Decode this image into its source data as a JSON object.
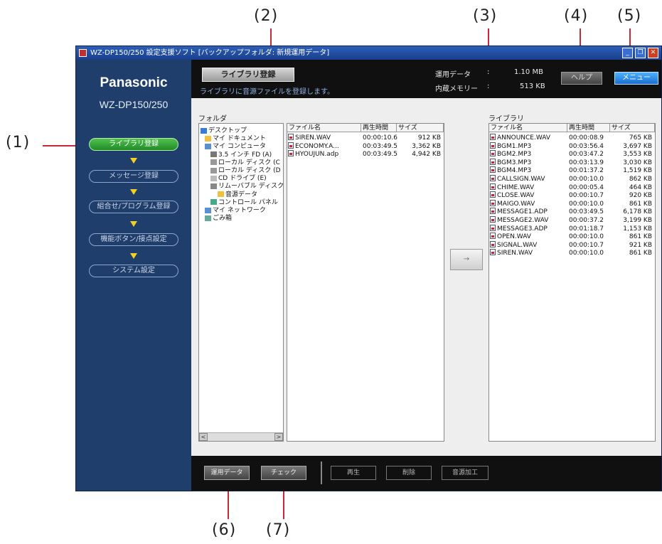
{
  "callouts": {
    "c1": "(1)",
    "c2": "(2)",
    "c3": "(3)",
    "c4": "(4)",
    "c5": "(5)",
    "c6": "(6)",
    "c7": "(7)"
  },
  "window": {
    "title": "WZ-DP150/250 設定支援ソフト [バックアップフォルダ: 新規運用データ]",
    "minimize": "_",
    "restore": "❐",
    "close": "✕"
  },
  "sidebar": {
    "brand": "Panasonic",
    "model": "WZ-DP150/250",
    "items": [
      {
        "label": "ライブラリ登録"
      },
      {
        "label": "メッセージ登録"
      },
      {
        "label": "組合せ/プログラム登録"
      },
      {
        "label": "機能ボタン/接点設定"
      },
      {
        "label": "システム設定"
      }
    ]
  },
  "header": {
    "library_button": "ライブラリ登録",
    "description": "ライブラリに音源ファイルを登録します。",
    "stats": [
      {
        "label": "運用データ",
        "colon": ":",
        "value": "1.10 MB"
      },
      {
        "label": "内蔵メモリー",
        "colon": ":",
        "value": "513 KB"
      }
    ],
    "help": "ヘルプ",
    "menu": "メニュー"
  },
  "folder_panel": {
    "label": "フォルダ",
    "tree": [
      {
        "text": "デスクトップ",
        "icon": "desktop-icon"
      },
      {
        "text": "マイ ドキュメント",
        "icon": "folder-icon"
      },
      {
        "text": "マイ コンピュータ",
        "icon": "computer-icon"
      },
      {
        "text": "3.5 インチ FD (A)",
        "icon": "floppy-icon"
      },
      {
        "text": "ローカル ディスク (C",
        "icon": "drive-icon"
      },
      {
        "text": "ローカル ディスク (D",
        "icon": "drive-icon"
      },
      {
        "text": "CD ドライブ (E)",
        "icon": "cd-icon"
      },
      {
        "text": "リムーバブル ディスク",
        "icon": "removable-icon"
      },
      {
        "text": "音源データ",
        "icon": "folder-open-icon"
      },
      {
        "text": "コントロール パネル",
        "icon": "control-panel-icon"
      },
      {
        "text": "マイ ネットワーク",
        "icon": "network-icon"
      },
      {
        "text": "ごみ箱",
        "icon": "recycle-bin-icon"
      }
    ],
    "scroll_left": "<",
    "scroll_right": ">"
  },
  "file_panel": {
    "headers": [
      "ファイル名",
      "再生時間",
      "サイズ"
    ],
    "rows": [
      [
        "SIREN.WAV",
        "00:00:10.6",
        "912 KB"
      ],
      [
        "ECONOMY.A...",
        "00:03:49.5",
        "3,362 KB"
      ],
      [
        "HYOUJUN.adp",
        "00:03:49.5",
        "4,942 KB"
      ]
    ]
  },
  "transfer_button": "→",
  "library_panel": {
    "label": "ライブラリ",
    "headers": [
      "ファイル名",
      "再生時間",
      "サイズ"
    ],
    "rows": [
      [
        "ANNOUNCE.WAV",
        "00:00:08.9",
        "765 KB"
      ],
      [
        "BGM1.MP3",
        "00:03:56.4",
        "3,697 KB"
      ],
      [
        "BGM2.MP3",
        "00:03:47.2",
        "3,553 KB"
      ],
      [
        "BGM3.MP3",
        "00:03:13.9",
        "3,030 KB"
      ],
      [
        "BGM4.MP3",
        "00:01:37.2",
        "1,519 KB"
      ],
      [
        "CALLSIGN.WAV",
        "00:00:10.0",
        "862 KB"
      ],
      [
        "CHIME.WAV",
        "00:00:05.4",
        "464 KB"
      ],
      [
        "CLOSE.WAV",
        "00:00:10.7",
        "920 KB"
      ],
      [
        "MAIGO.WAV",
        "00:00:10.0",
        "861 KB"
      ],
      [
        "MESSAGE1.ADP",
        "00:03:49.5",
        "6,178 KB"
      ],
      [
        "MESSAGE2.WAV",
        "00:00:37.2",
        "3,199 KB"
      ],
      [
        "MESSAGE3.ADP",
        "00:01:18.7",
        "1,153 KB"
      ],
      [
        "OPEN.WAV",
        "00:00:10.0",
        "861 KB"
      ],
      [
        "SIGNAL.WAV",
        "00:00:10.7",
        "921 KB"
      ],
      [
        "SIREN.WAV",
        "00:00:10.0",
        "861 KB"
      ]
    ]
  },
  "bottom": {
    "data_button": "運用データ",
    "check_button": "チェック",
    "play_button": "再生",
    "delete_button": "削除",
    "process_button": "音源加工"
  },
  "colors": {
    "accent_callout": "#c8283a",
    "active_nav": "#2a9a30",
    "menu_button": "#2a86e8"
  }
}
